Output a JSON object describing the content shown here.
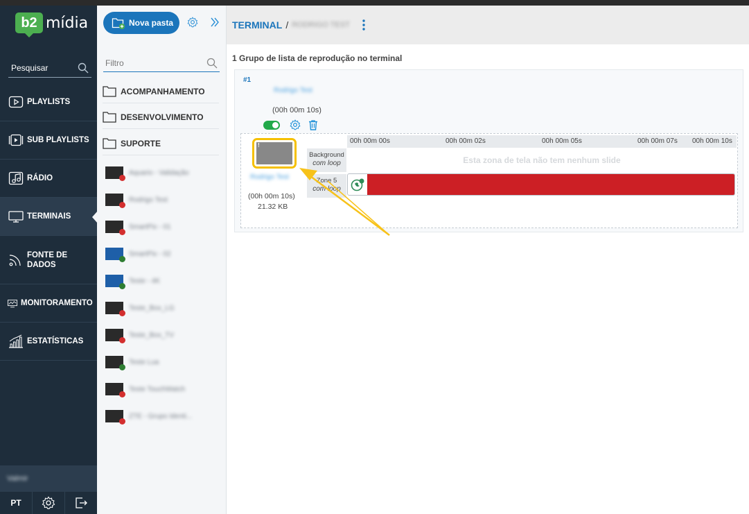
{
  "app": {
    "logo_badge": "b2",
    "logo_text": "mídia"
  },
  "sidebar": {
    "search_placeholder": "Pesquisar",
    "items": [
      {
        "label": "PLAYLISTS"
      },
      {
        "label": "SUB PLAYLISTS"
      },
      {
        "label": "RÁDIO"
      },
      {
        "label": "TERMINAIS"
      },
      {
        "label_line1": "FONTE DE",
        "label_line2": "DADOS"
      },
      {
        "label": "MONITORAMENTO"
      },
      {
        "label": "ESTATÍSTICAS"
      }
    ],
    "user_name": "Valmir",
    "language": "PT"
  },
  "folders": {
    "new_folder_label": "Nova pasta",
    "filter_placeholder": "Filtro",
    "folder_items": [
      "ACOMPANHAMENTO",
      "DESENVOLVIMENTO",
      "SUPORTE"
    ],
    "terminals": [
      {
        "name": "Aquario - Validação",
        "status_color": "#d32f2f",
        "screen": "dark"
      },
      {
        "name": "Rodrigo Test",
        "status_color": "#d32f2f",
        "screen": "dark"
      },
      {
        "name": "SmartPix - 01",
        "status_color": "#d32f2f",
        "screen": "dark"
      },
      {
        "name": "SmartPix - 02",
        "status_color": "#2e7d32",
        "screen": "blue"
      },
      {
        "name": "Teste - 4K",
        "status_color": "#2e7d32",
        "screen": "blue"
      },
      {
        "name": "Teste_Box_LG",
        "status_color": "#d32f2f",
        "screen": "dark"
      },
      {
        "name": "Teste_Box_TV",
        "status_color": "#d32f2f",
        "screen": "dark"
      },
      {
        "name": "Teste Lua",
        "status_color": "#2e7d32",
        "screen": "dark"
      },
      {
        "name": "Teste TouchWatch",
        "status_color": "#d32f2f",
        "screen": "dark"
      },
      {
        "name": "ZTE - Grupo Identi...",
        "status_color": "#d32f2f",
        "screen": "dark"
      }
    ]
  },
  "header": {
    "crumb": "TERMINAL",
    "separator": "/",
    "terminal_name": "RODRIGO TEST"
  },
  "main": {
    "group_title": "1 Grupo de lista de reprodução no terminal",
    "group": {
      "number": "#1",
      "name": "Rodrigo Test",
      "duration": "(00h 00m 10s)",
      "enabled": true,
      "item": {
        "name": "Rodrigo Test",
        "duration": "(00h 00m 10s)",
        "size": "21.32 KB"
      },
      "ruler": [
        "00h 00m 00s",
        "00h 00m 02s",
        "00h 00m 05s",
        "00h 00m 07s",
        "00h 00m 10s"
      ],
      "zones": [
        {
          "name": "Background",
          "mode": "com loop",
          "empty_text": "Esta zona de tela não tem nenhum slide"
        },
        {
          "name": "Zone 5",
          "mode": "com loop",
          "slide_color": "#cc1f25"
        }
      ]
    }
  },
  "colors": {
    "sidebar_bg": "#1e2d3b",
    "accent": "#1b75bb",
    "brand_green": "#4caf50",
    "highlight": "#f5c000"
  }
}
